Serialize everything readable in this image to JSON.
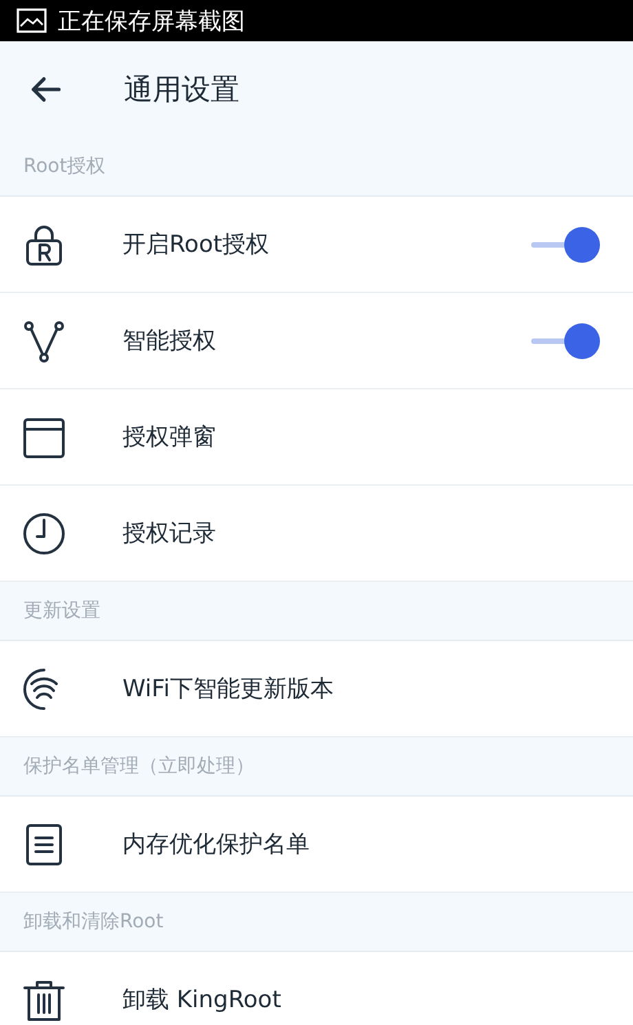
{
  "status_bar": {
    "text": "正在保存屏幕截图"
  },
  "header": {
    "title": "通用设置"
  },
  "sections": [
    {
      "title": "Root授权",
      "items": [
        {
          "label": "开启Root授权",
          "kind": "toggle",
          "on": true
        },
        {
          "label": "智能授权",
          "kind": "toggle",
          "on": true
        },
        {
          "label": "授权弹窗",
          "kind": "plain"
        },
        {
          "label": "授权记录",
          "kind": "plain"
        }
      ]
    },
    {
      "title": "更新设置",
      "items": [
        {
          "label": "WiFi下智能更新版本",
          "kind": "plain"
        }
      ]
    },
    {
      "title": "保护名单管理（立即处理）",
      "items": [
        {
          "label": "内存优化保护名单",
          "kind": "plain"
        }
      ]
    },
    {
      "title": "卸载和清除Root",
      "items": [
        {
          "label": "卸载 KingRoot",
          "kind": "plain"
        }
      ]
    }
  ]
}
